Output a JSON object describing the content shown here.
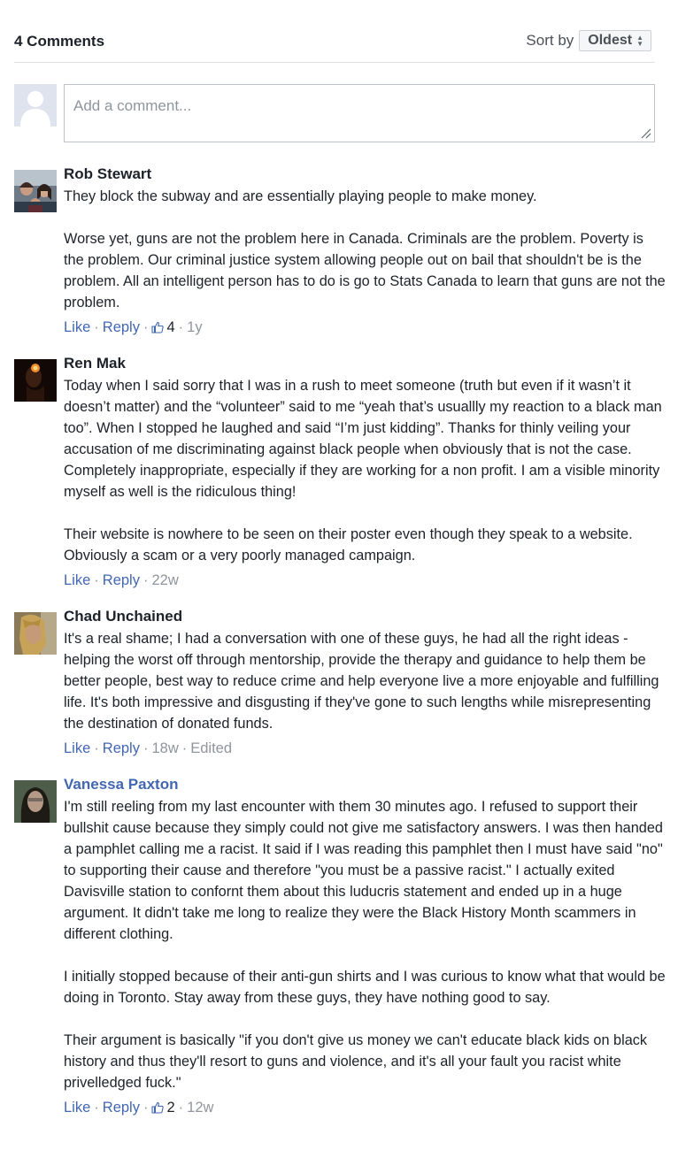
{
  "header": {
    "comment_count": "4 Comments",
    "sort_label": "Sort by",
    "sort_value": "Oldest"
  },
  "composer": {
    "placeholder": "Add a comment..."
  },
  "comments": [
    {
      "author": "Rob Stewart",
      "paragraphs": [
        "They block the subway and are essentially playing people to make money.",
        "Worse yet, guns are not the problem here in Canada. Criminals are the problem. Poverty is the problem. Our criminal justice system allowing people out on bail that shouldn't be is the problem. All an intelligent person has to do is go to Stats Canada to learn that guns are not the problem."
      ],
      "like_label": "Like",
      "reply_label": "Reply",
      "likes": "4",
      "time": "1y"
    },
    {
      "author": "Ren Mak",
      "paragraphs": [
        "Today when I said sorry that I was in a rush to meet someone (truth but even if it wasn’t it doesn’t matter) and the “volunteer” said to me “yeah that’s usuallly my reaction to a black man too”. When I stopped he laughed and said “I’m just kidding”. Thanks for thinly veiling your accusation of me discriminating against black people when obviously that is not the case. Completely inappropriate, especially if they are working for a non profit. I am a visible minority myself as well is the ridiculous thing!",
        "Their website is nowhere to be seen on their poster even though they speak to a website. Obviously a scam or a very poorly managed campaign."
      ],
      "like_label": "Like",
      "reply_label": "Reply",
      "time": "22w"
    },
    {
      "author": "Chad Unchained",
      "paragraphs": [
        "It's a real shame; I had a conversation with one of these guys, he had all the right ideas - helping the worst off through mentorship, provide the therapy and guidance to help them be better people, best way to reduce crime and help everyone live a more enjoyable and fulfilling life. It's both impressive and disgusting if they've gone to such lengths while misrepresenting the destination of donated funds."
      ],
      "like_label": "Like",
      "reply_label": "Reply",
      "time": "18w",
      "edited": "Edited"
    },
    {
      "author": "Vanessa Paxton",
      "paragraphs": [
        "I'm still reeling from my last encounter with them 30 minutes ago. I refused to support their bullshit cause because they simply could not give me satisfactory answers. I was then handed a pamphlet calling me a racist. It said if I was reading this pamphlet then I must have said \"no\" to supporting their cause and therefore \"you must be a passive racist.\" I actually exited Davisville station to confornt them about this luducris statement and ended up in a huge argument. It didn't take me long to realize they were the Black History Month scammers in different clothing.",
        "I initially stopped because of their anti-gun shirts and I was curious to know what that would be doing in Toronto. Stay away from these guys, they have nothing good to say.",
        "Their argument is basically \"if you don't give us money we can't educate black kids on black history and thus they'll resort to guns and violence, and it's all your fault you racist white privelledged fuck.\""
      ],
      "like_label": "Like",
      "reply_label": "Reply",
      "likes": "2",
      "time": "12w"
    }
  ]
}
